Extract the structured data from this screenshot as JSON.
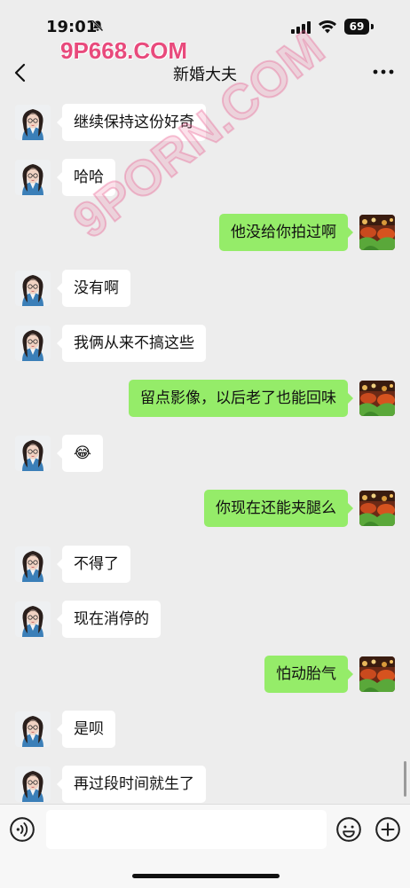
{
  "status_bar": {
    "time": "19:01",
    "battery": "69"
  },
  "navbar": {
    "title": "新婚大夫"
  },
  "watermarks": {
    "top": "9P668.COM",
    "diagonal": "9PORN.COM"
  },
  "messages": [
    {
      "side": "left",
      "text": "继续保持这份好奇"
    },
    {
      "side": "left",
      "text": "哈哈"
    },
    {
      "side": "right",
      "text": "他没给你拍过啊"
    },
    {
      "side": "left",
      "text": "没有啊"
    },
    {
      "side": "left",
      "text": "我俩从来不搞这些"
    },
    {
      "side": "right",
      "text": "留点影像，以后老了也能回味"
    },
    {
      "side": "left",
      "text": "😂"
    },
    {
      "side": "right",
      "text": "你现在还能夹腿么"
    },
    {
      "side": "left",
      "text": "不得了"
    },
    {
      "side": "left",
      "text": "现在消停的"
    },
    {
      "side": "right",
      "text": "怕动胎气"
    },
    {
      "side": "left",
      "text": "是呗"
    },
    {
      "side": "left",
      "text": "再过段时间就生了"
    }
  ],
  "input_bar": {
    "placeholder": ""
  },
  "icons": {
    "back": "chevron-left-icon",
    "more": "more-horizontal-icon",
    "voice": "voice-icon",
    "emoji": "emoji-icon",
    "plus": "plus-icon"
  },
  "colors": {
    "background": "#ededed",
    "bubble_self": "#95ec69",
    "bubble_other": "#ffffff"
  }
}
